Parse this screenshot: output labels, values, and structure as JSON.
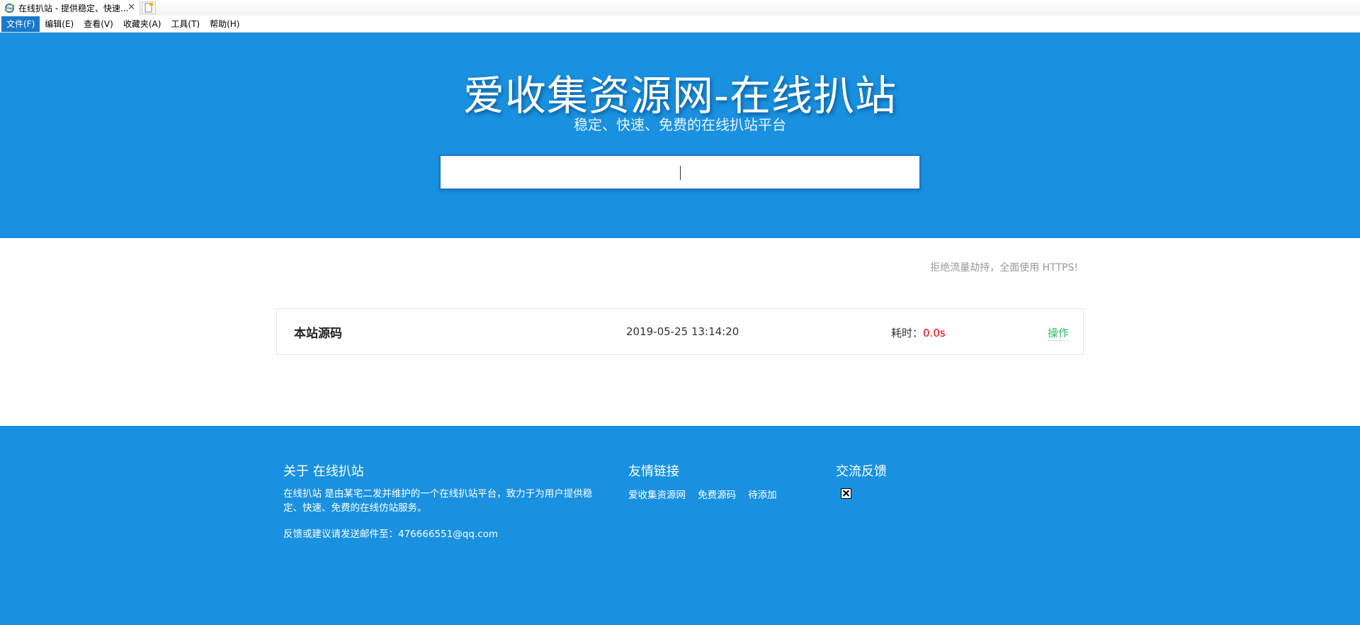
{
  "browser": {
    "tab_title": "在线扒站 - 提供稳定、快速...",
    "tab_close": "✕",
    "menu": [
      "文件(F)",
      "编辑(E)",
      "查看(V)",
      "收藏夹(A)",
      "工具(T)",
      "帮助(H)"
    ],
    "active_menu_index": 0,
    "accent_color": "#1979ca"
  },
  "hero": {
    "title": "爱收集资源网-在线扒站",
    "subtitle": "稳定、快速、免费的在线扒站平台",
    "search_value": "",
    "background_color": "#1991e0"
  },
  "notice": "拒绝流量劫持，全面使用 HTTPS!",
  "results": [
    {
      "name": "本站源码",
      "time": "2019-05-25 13:14:20",
      "cost_label": "耗时：",
      "cost_value": "0.0s",
      "action": "操作"
    }
  ],
  "footer": {
    "about": {
      "heading": "关于 在线扒站",
      "description": "在线扒站 是由某宅二发并维护的一个在线扒站平台，致力于为用户提供稳定、快速、免费的在线仿站服务。",
      "email_line": "反馈或建议请发送邮件至：476666551@qq.com"
    },
    "links": {
      "heading": "友情链接",
      "items": [
        "爱收集资源网",
        "免费源码",
        "待添加"
      ]
    },
    "feedback": {
      "heading": "交流反馈",
      "image_icon": "broken-image-icon"
    }
  }
}
